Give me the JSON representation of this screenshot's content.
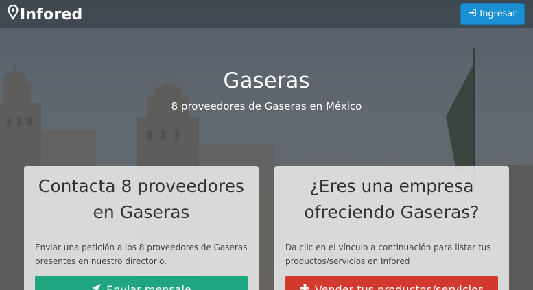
{
  "brand": {
    "name": "Infored",
    "icon": "map-pin-icon"
  },
  "navbar": {
    "login_label": "Ingresar",
    "login_icon": "sign-in-icon",
    "login_color": "#1a8fd4"
  },
  "hero": {
    "title": "Gaseras",
    "subtitle": "8 proveedores de Gaseras en México"
  },
  "cards": [
    {
      "title": "Contacta 8 proveedores en Gaseras",
      "body": "Enviar una petición a los 8 proveedores de Gaseras presentes en nuestro directorio.",
      "button_label": "Enviar mensaje",
      "button_icon": "paper-plane-icon",
      "button_color": "#1fa57f"
    },
    {
      "title": "¿Eres una empresa ofreciendo Gaseras?",
      "body": "Da clic en el vínculo a continuación para listar tus productos/servicios en Infored",
      "button_label": "Vender tus productos/servicios",
      "button_icon": "plus-icon",
      "button_color": "#d33a2f"
    }
  ]
}
